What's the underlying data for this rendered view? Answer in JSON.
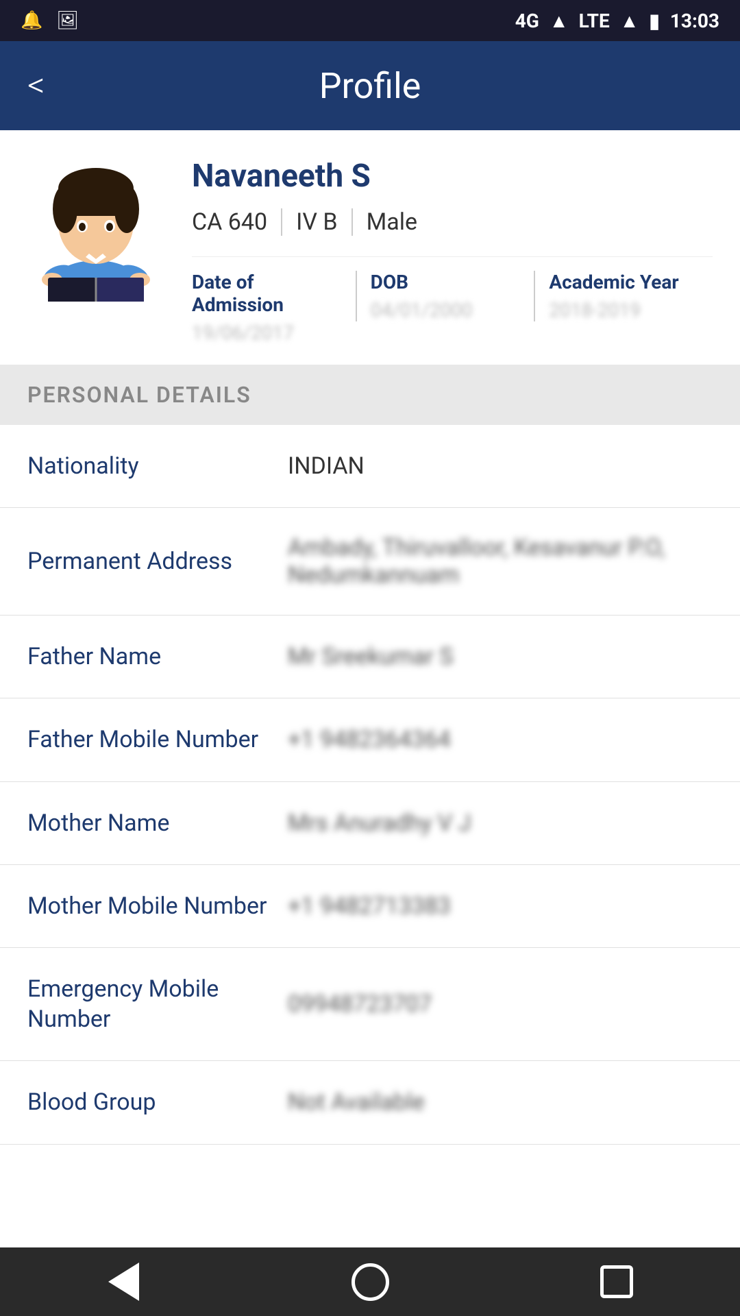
{
  "statusBar": {
    "time": "13:03",
    "signal": "4G",
    "lte": "LTE"
  },
  "header": {
    "title": "Profile",
    "backLabel": "<"
  },
  "profile": {
    "name": "Navaneeth S",
    "roll": "CA 640",
    "section": "IV B",
    "gender": "Male",
    "dateOfAdmissionLabel": "Date of Admission",
    "dateOfAdmissionValue": "19/06/2017",
    "dobLabel": "DOB",
    "dobValue": "04/01/2000",
    "academicYearLabel": "Academic Year",
    "academicYearValue": "2018-2019"
  },
  "personalDetails": {
    "sectionTitle": "PERSONAL DETAILS",
    "rows": [
      {
        "label": "Nationality",
        "value": "INDIAN",
        "blurred": false
      },
      {
        "label": "Permanent Address",
        "value": "Ambady, Thiruvalloor, Kesavanur P.O, Nedumkannuam",
        "blurred": true
      },
      {
        "label": "Father Name",
        "value": "Mr Sreekumar S",
        "blurred": true
      },
      {
        "label": "Father Mobile Number",
        "value": "+1 9482364364",
        "blurred": true
      },
      {
        "label": "Mother Name",
        "value": "Mrs Anuradhy V J",
        "blurred": true
      },
      {
        "label": "Mother Mobile Number",
        "value": "+1 9482713383",
        "blurred": true
      },
      {
        "label": "Emergency Mobile Number",
        "value": "09948723707",
        "blurred": true
      },
      {
        "label": "Blood Group",
        "value": "Not Available",
        "blurred": true
      }
    ]
  },
  "bottomNav": {
    "back": "back",
    "home": "home",
    "recent": "recent"
  }
}
